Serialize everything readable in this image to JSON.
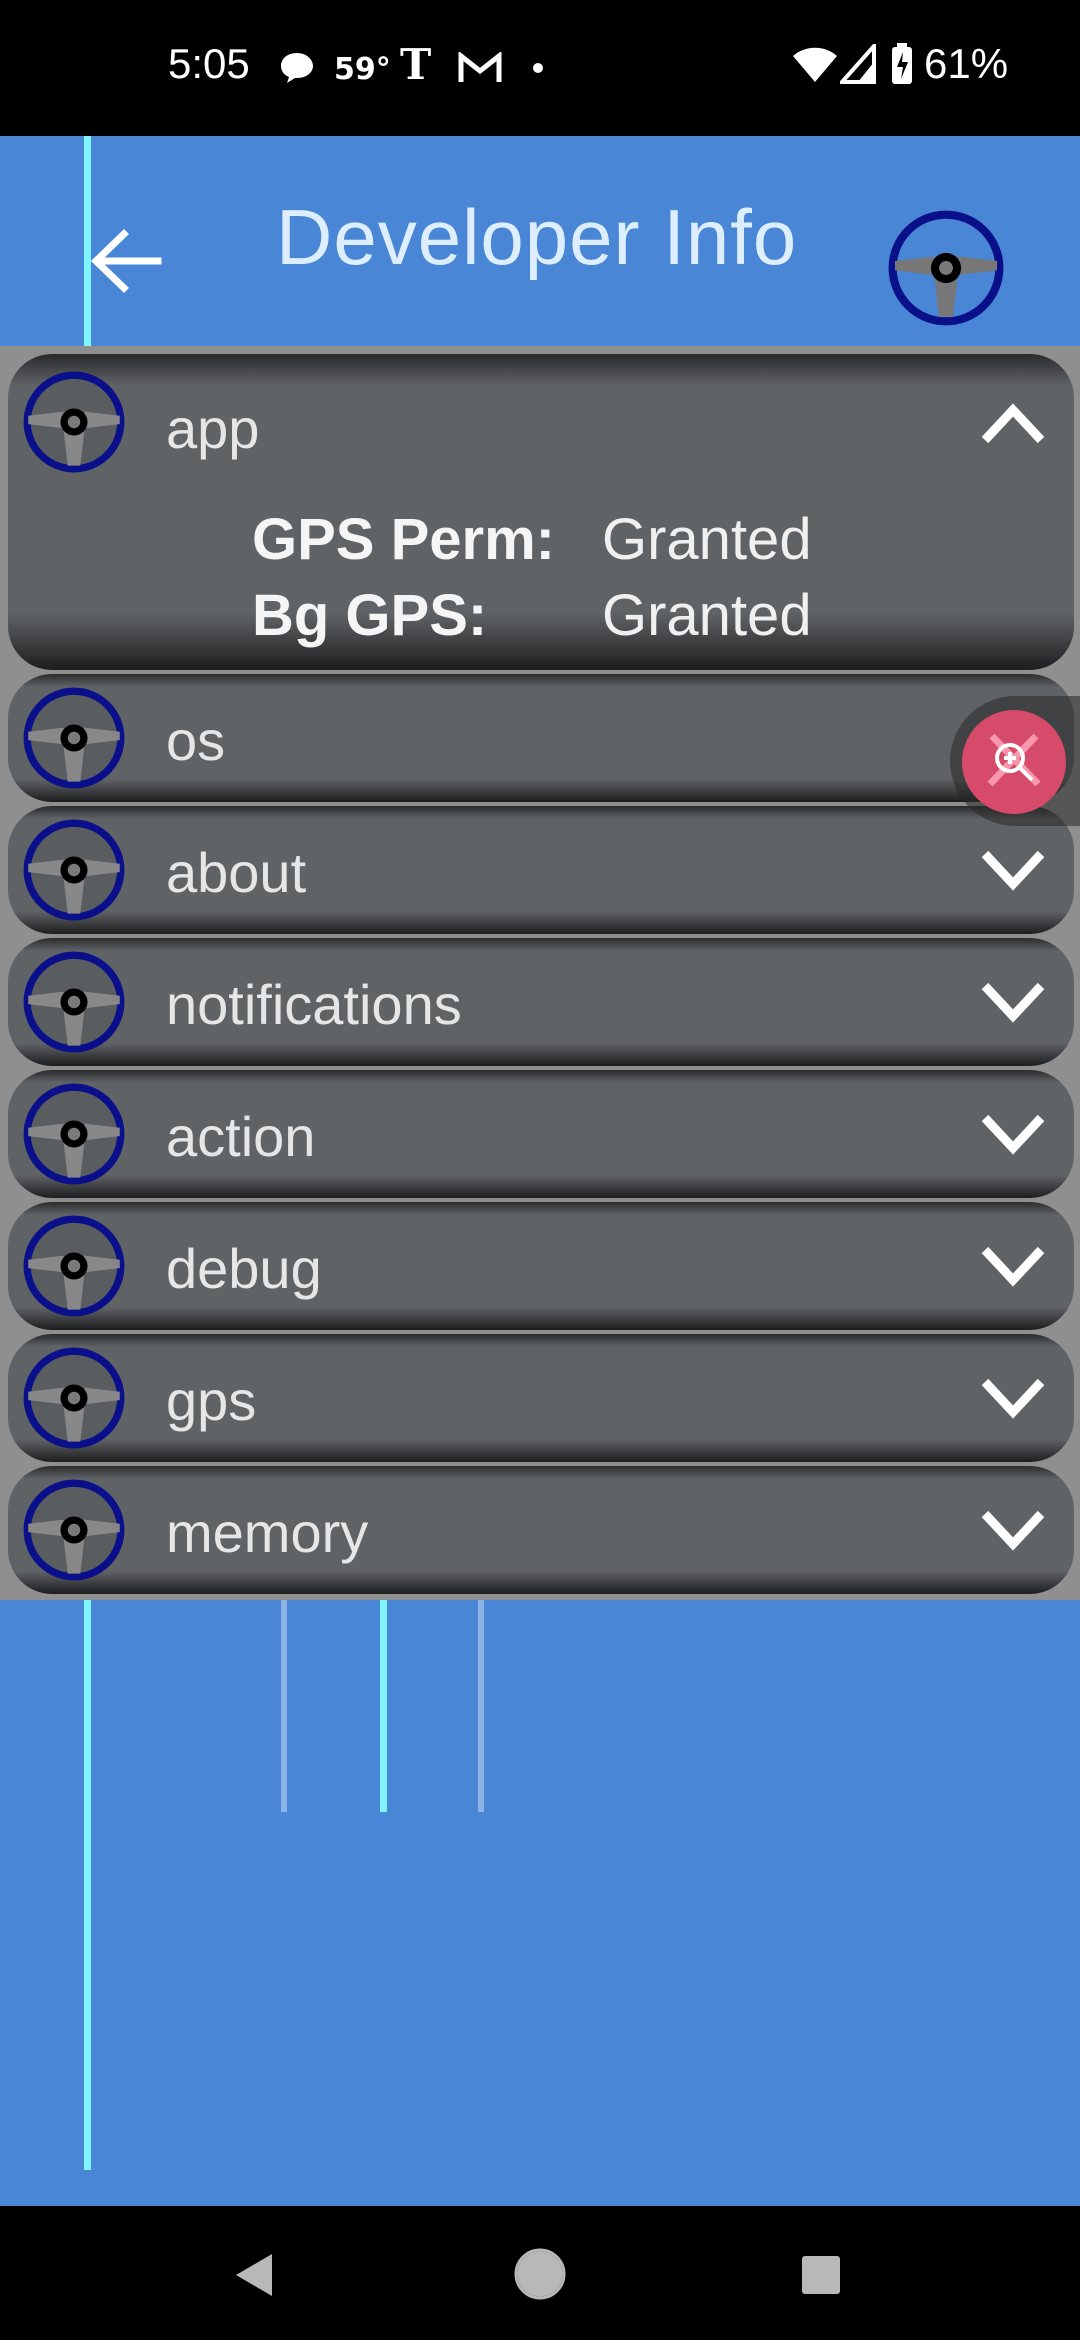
{
  "status_bar": {
    "time": "5:05",
    "temperature": "59°",
    "battery": "61%",
    "icons": [
      "chat-bubble-icon",
      "nytimes-icon",
      "gmail-icon",
      "dot-icon",
      "wifi-icon",
      "signal-icon",
      "battery-charging-icon"
    ]
  },
  "app_bar": {
    "title": "Developer Info",
    "back_icon": "arrow-left-icon",
    "logo_icon": "steering-wheel-icon"
  },
  "sections": [
    {
      "label": "app",
      "expanded": true
    },
    {
      "label": "os",
      "expanded": false
    },
    {
      "label": "about",
      "expanded": false
    },
    {
      "label": "notifications",
      "expanded": false
    },
    {
      "label": "action",
      "expanded": false
    },
    {
      "label": "debug",
      "expanded": false
    },
    {
      "label": "gps",
      "expanded": false
    },
    {
      "label": "memory",
      "expanded": false
    }
  ],
  "app_details": {
    "gps_perm_label": "GPS Perm:",
    "gps_perm_value": "Granted",
    "bg_gps_label": "Bg GPS:",
    "bg_gps_value": "Granted"
  },
  "floating_button": {
    "icon": "zoom-in-icon"
  },
  "nav": {
    "icons": [
      "back-triangle-icon",
      "home-circle-icon",
      "recents-square-icon"
    ]
  },
  "colors": {
    "background": "#4a86d6",
    "row": "#606366",
    "accent_line": "#7ff6ff",
    "fab": "#d64a6a",
    "wheel_rim": "#0a0f8a"
  }
}
